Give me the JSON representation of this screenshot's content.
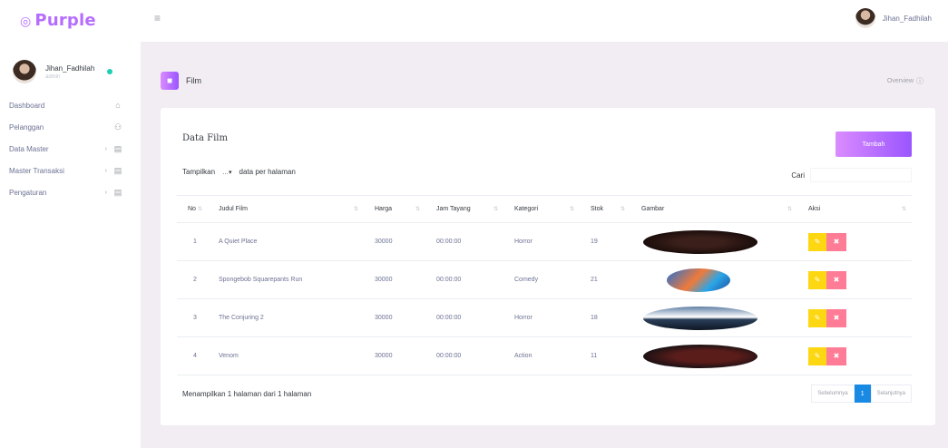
{
  "brand": {
    "name": "Purple",
    "logo_glyph": "◎"
  },
  "navbar": {
    "menu_icon": "hamburger-icon",
    "menu_glyph": "≡",
    "user_name": "Jihan_Fadhilah"
  },
  "sidebar": {
    "profile_name": "Jihan_Fadhilah",
    "profile_role": "admin",
    "items": [
      {
        "label": "Dashboard",
        "icon": "home-icon",
        "glyph": "⌂",
        "chevron": ""
      },
      {
        "label": "Pelanggan",
        "icon": "users-icon",
        "glyph": "⚇",
        "chevron": ""
      },
      {
        "label": "Data Master",
        "icon": "grid-icon",
        "glyph": "▤",
        "chevron": "›"
      },
      {
        "label": "Master Transaksi",
        "icon": "grid-icon",
        "glyph": "▤",
        "chevron": "›"
      },
      {
        "label": "Pengaturan",
        "icon": "settings-icon",
        "glyph": "▤",
        "chevron": "›"
      }
    ]
  },
  "page": {
    "title": "Film",
    "icon_glyph": "■",
    "overview_label": "Overview",
    "overview_glyph": "ⓘ"
  },
  "card": {
    "title": "Data Film",
    "add_button": "Tambah",
    "length_prefix": "Tampilkan",
    "length_value": "…▾",
    "length_suffix": "data per halaman",
    "search_label": "Cari",
    "search_placeholder": ""
  },
  "table": {
    "columns": [
      "No",
      "Judul Film",
      "Harga",
      "Jam Tayang",
      "Kategori",
      "Stok",
      "Gambar",
      "Aksi"
    ],
    "rows": [
      {
        "no": "1",
        "judul": "A Quiet Place",
        "harga": "30000",
        "jam": "00:00:00",
        "kategori": "Horror",
        "stok": "19"
      },
      {
        "no": "2",
        "judul": "Spongebob Squarepants Run",
        "harga": "30000",
        "jam": "00:00:00",
        "kategori": "Comedy",
        "stok": "21"
      },
      {
        "no": "3",
        "judul": "The Conjuring 2",
        "harga": "30000",
        "jam": "00:00:00",
        "kategori": "Horror",
        "stok": "18"
      },
      {
        "no": "4",
        "judul": "Venom",
        "harga": "30000",
        "jam": "00:00:00",
        "kategori": "Action",
        "stok": "11"
      }
    ],
    "edit_glyph": "✎",
    "delete_glyph": "✖"
  },
  "footer": {
    "info": "Menampilkan 1 halaman dari 1 halaman",
    "prev": "Sebelumnya",
    "page": "1",
    "next": "Selanjutnya"
  },
  "colors": {
    "accent": "#b66dff",
    "edit": "#fed713",
    "delete": "#fe7c96",
    "page_active": "#198ae3",
    "background": "#f2edf3"
  }
}
